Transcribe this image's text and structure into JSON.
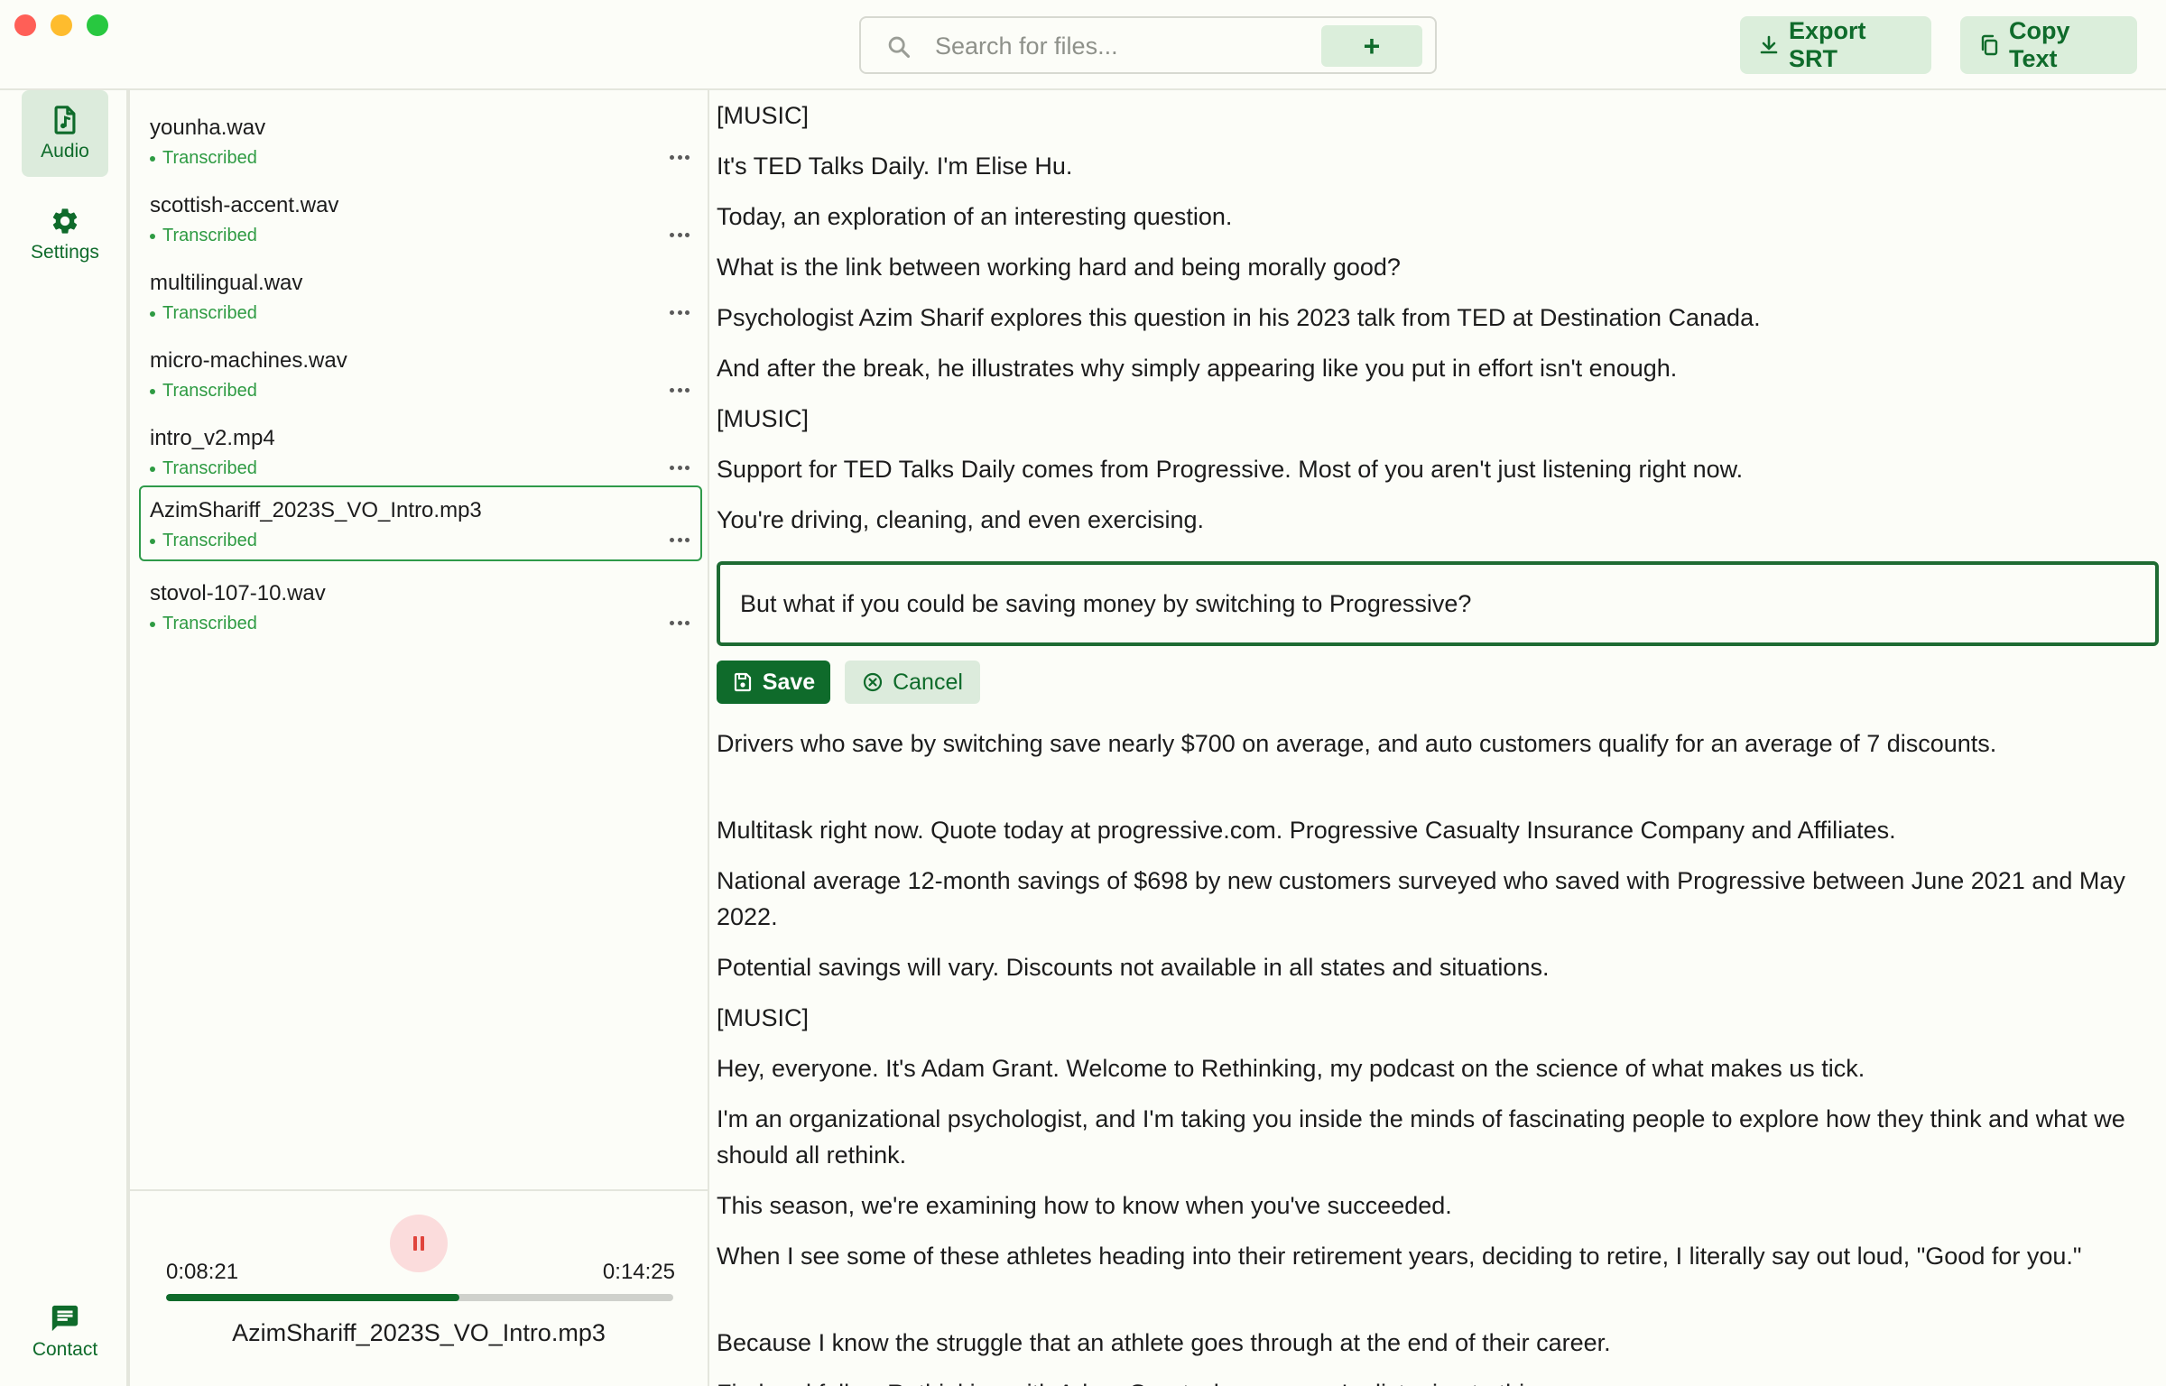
{
  "search": {
    "placeholder": "Search for files...",
    "add_label": "+"
  },
  "toolbar": {
    "export_label": "Export SRT",
    "copy_label": "Copy Text"
  },
  "nav": {
    "audio_label": "Audio",
    "settings_label": "Settings",
    "contact_label": "Contact"
  },
  "files": [
    {
      "name": "younha.wav",
      "status": "Transcribed"
    },
    {
      "name": "scottish-accent.wav",
      "status": "Transcribed"
    },
    {
      "name": "multilingual.wav",
      "status": "Transcribed"
    },
    {
      "name": "micro-machines.wav",
      "status": "Transcribed"
    },
    {
      "name": "intro_v2.mp4",
      "status": "Transcribed"
    },
    {
      "name": "AzimShariff_2023S_VO_Intro.mp3",
      "status": "Transcribed",
      "selected": true
    },
    {
      "name": "stovol-107-10.wav",
      "status": "Transcribed"
    }
  ],
  "player": {
    "current_time": "0:08:21",
    "total_time": "0:14:25",
    "progress": 0.579,
    "file_name": "AzimShariff_2023S_VO_Intro.mp3"
  },
  "transcript": {
    "before": [
      "[MUSIC]",
      "It's TED Talks Daily. I'm Elise Hu.",
      "Today, an exploration of an interesting question.",
      "What is the link between working hard and being morally good?",
      "Psychologist Azim Sharif explores this question in his 2023 talk from TED at Destination Canada.",
      "And after the break, he illustrates why simply appearing like you put in effort isn't enough.",
      "[MUSIC]",
      "Support for TED Talks Daily comes from Progressive. Most of you aren't just listening right now.",
      "You're driving, cleaning, and even exercising."
    ],
    "editing": "But what if you could be saving money by switching to Progressive?",
    "save_label": "Save",
    "cancel_label": "Cancel",
    "after": [
      "Drivers who save by switching save nearly $700 on average, and auto customers qualify for an average of 7 discounts.",
      "Multitask right now. Quote today at progressive.com. Progressive Casualty Insurance Company and Affiliates.",
      "National average 12-month savings of $698 by new customers surveyed who saved with Progressive between June 2021 and May 2022.",
      "Potential savings will vary. Discounts not available in all states and situations.",
      "[MUSIC]",
      "Hey, everyone. It's Adam Grant. Welcome to Rethinking, my podcast on the science of what makes us tick.",
      "I'm an organizational psychologist, and I'm taking you inside the minds of fascinating people to explore how they think and what we should all rethink.",
      "This season, we're examining how to know when you've succeeded.",
      "When I see some of these athletes heading into their retirement years, deciding to retire, I literally say out loud, \"Good for you.\"",
      "Because I know the struggle that an athlete goes through at the end of their career.",
      "Find and follow Rethinking with Adam Grant wherever you're listening to this."
    ]
  },
  "colors": {
    "accent": "#0f6b2b",
    "accent_light": "#dbeedb",
    "status_green": "#2e9b43",
    "pause_bg": "#fbdcdc",
    "pause_icon": "#e0443c"
  }
}
